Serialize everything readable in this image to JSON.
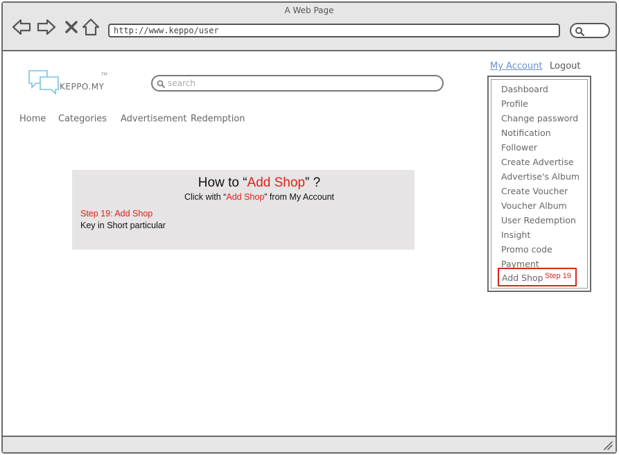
{
  "window": {
    "title": "A Web Page"
  },
  "browser": {
    "url": "http://www.keppo/user"
  },
  "site": {
    "logo_text": "KEPPO.MY",
    "logo_tm": "TM",
    "search_placeholder": "search"
  },
  "nav": {
    "items": [
      "Home",
      "Categories",
      "Advertisement",
      "Redemption"
    ]
  },
  "account": {
    "my_account": "My Account",
    "logout": "Logout"
  },
  "menu": {
    "items": [
      "Dashboard",
      "Profile",
      "Change password",
      "Notification",
      "Follower",
      "Create Advertise",
      "Advertise's Album",
      "Create Voucher",
      "Voucher Album",
      "User Redemption",
      "Insight",
      "Promo code",
      "Payment"
    ],
    "highlight_label": "Add Shop",
    "highlight_step": "Step 19"
  },
  "instructions": {
    "title_prefix": "How to  “",
    "title_highlight": "Add Shop",
    "title_suffix": "” ?",
    "sub_prefix": "Click with “",
    "sub_highlight": "Add Shop",
    "sub_suffix": "”  from  My Account",
    "step_title": "Step 19: Add Shop",
    "step_desc": "Key in Short particular"
  },
  "colors": {
    "accent_red": "#e0201a",
    "link_blue": "#6a8fc4",
    "panel_bg": "#e6e4e4",
    "chrome_bg": "#e6e6e6"
  }
}
